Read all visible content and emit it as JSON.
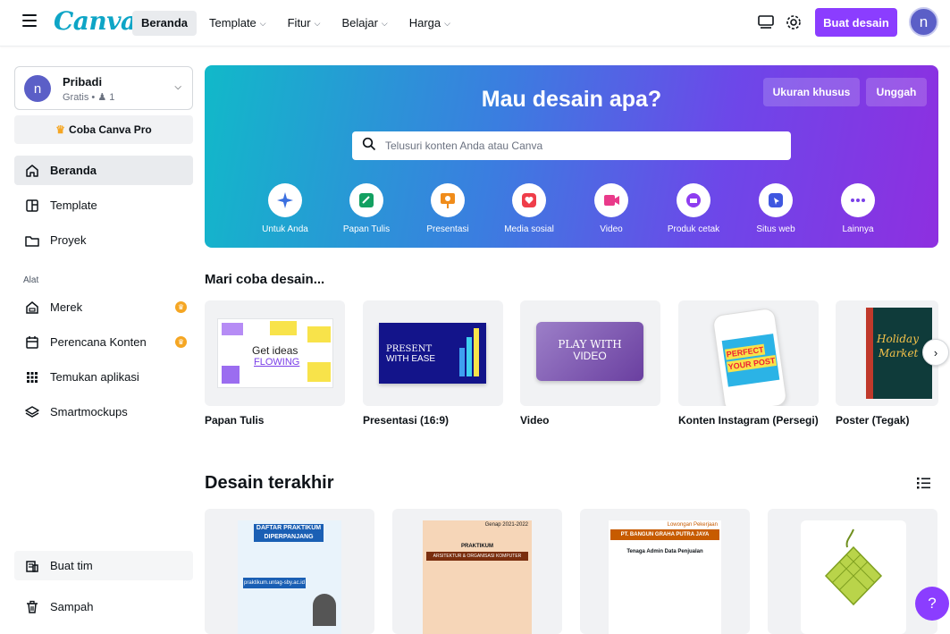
{
  "app": {
    "logo": "Canva"
  },
  "topnav": {
    "items": [
      {
        "label": "Beranda",
        "active": true,
        "dropdown": false
      },
      {
        "label": "Template",
        "dropdown": true
      },
      {
        "label": "Fitur",
        "dropdown": true
      },
      {
        "label": "Belajar",
        "dropdown": true
      },
      {
        "label": "Harga",
        "dropdown": true
      }
    ],
    "create_button": "Buat desain",
    "avatar_initial": "n",
    "brand_color": "#8b3dff"
  },
  "sidebar": {
    "account": {
      "initial": "n",
      "name": "Pribadi",
      "plan": "Gratis • ",
      "members": "1"
    },
    "pro_label": "Coba Canva Pro",
    "items": [
      {
        "label": "Beranda",
        "icon": "home-icon",
        "active": true
      },
      {
        "label": "Template",
        "icon": "template-icon"
      },
      {
        "label": "Proyek",
        "icon": "folder-icon"
      }
    ],
    "section_label": "Alat",
    "tools": [
      {
        "label": "Merek",
        "icon": "brand-icon",
        "pro": true
      },
      {
        "label": "Perencana Konten",
        "icon": "calendar-icon",
        "pro": true
      },
      {
        "label": "Temukan aplikasi",
        "icon": "apps-icon"
      },
      {
        "label": "Smartmockups",
        "icon": "layers-icon"
      }
    ],
    "bottom": [
      {
        "label": "Buat tim",
        "icon": "team-icon"
      },
      {
        "label": "Sampah",
        "icon": "trash-icon"
      }
    ]
  },
  "hero": {
    "title": "Mau desain apa?",
    "custom_size": "Ukuran khusus",
    "upload": "Unggah",
    "search_placeholder": "Telusuri konten Anda atau Canva",
    "categories": [
      {
        "label": "Untuk Anda",
        "icon": "sparkle-icon",
        "color": "#3b6fe0"
      },
      {
        "label": "Papan Tulis",
        "icon": "whiteboard-icon",
        "color": "#13a061"
      },
      {
        "label": "Presentasi",
        "icon": "presentation-icon",
        "color": "#f08c1a"
      },
      {
        "label": "Media sosial",
        "icon": "heart-icon",
        "color": "#ef3e4a"
      },
      {
        "label": "Video",
        "icon": "video-icon",
        "color": "#e93a8a"
      },
      {
        "label": "Produk cetak",
        "icon": "print-icon",
        "color": "#8e3df0"
      },
      {
        "label": "Situs web",
        "icon": "web-icon",
        "color": "#3f57e0"
      },
      {
        "label": "Lainnya",
        "icon": "more-icon",
        "color": "#7a3fe8"
      }
    ]
  },
  "try_section": {
    "title": "Mari coba desain...",
    "tiles": [
      {
        "label": "Papan Tulis",
        "thumb_text": "Get ideas",
        "thumb_text2": "FLOWING"
      },
      {
        "label": "Presentasi (16:9)",
        "thumb_text": "PRESENT",
        "thumb_text2": "WITH EASE"
      },
      {
        "label": "Video",
        "thumb_text": "PLAY WITH",
        "thumb_text2": "VIDEO"
      },
      {
        "label": "Konten Instagram (Persegi)",
        "thumb_text": "PERFECT",
        "thumb_text2": "YOUR POST"
      },
      {
        "label": "Poster (Tegak)",
        "thumb_text": "Holiday",
        "thumb_text2": "Market"
      }
    ]
  },
  "recent_section": {
    "title": "Desain terakhir",
    "items": [
      {
        "thumb_title": "DAFTAR PRAKTIKUM DIPERPANJANG",
        "thumb_sub": "praktikum.untag-sby.ac.id"
      },
      {
        "thumb_title": "PRAKTIKUM",
        "thumb_sub": "ARSITEKTUR & ORGANISASI KOMPUTER",
        "thumb_extra": "Genap 2021-2022"
      },
      {
        "thumb_title": "PT. BANGUN GRAHA PUTRA JAYA",
        "thumb_sub": "Tenaga Admin Data Penjualan",
        "thumb_extra": "Lowongan Pekerjaan"
      },
      {
        "thumb_title": ""
      }
    ]
  },
  "help_label": "?"
}
